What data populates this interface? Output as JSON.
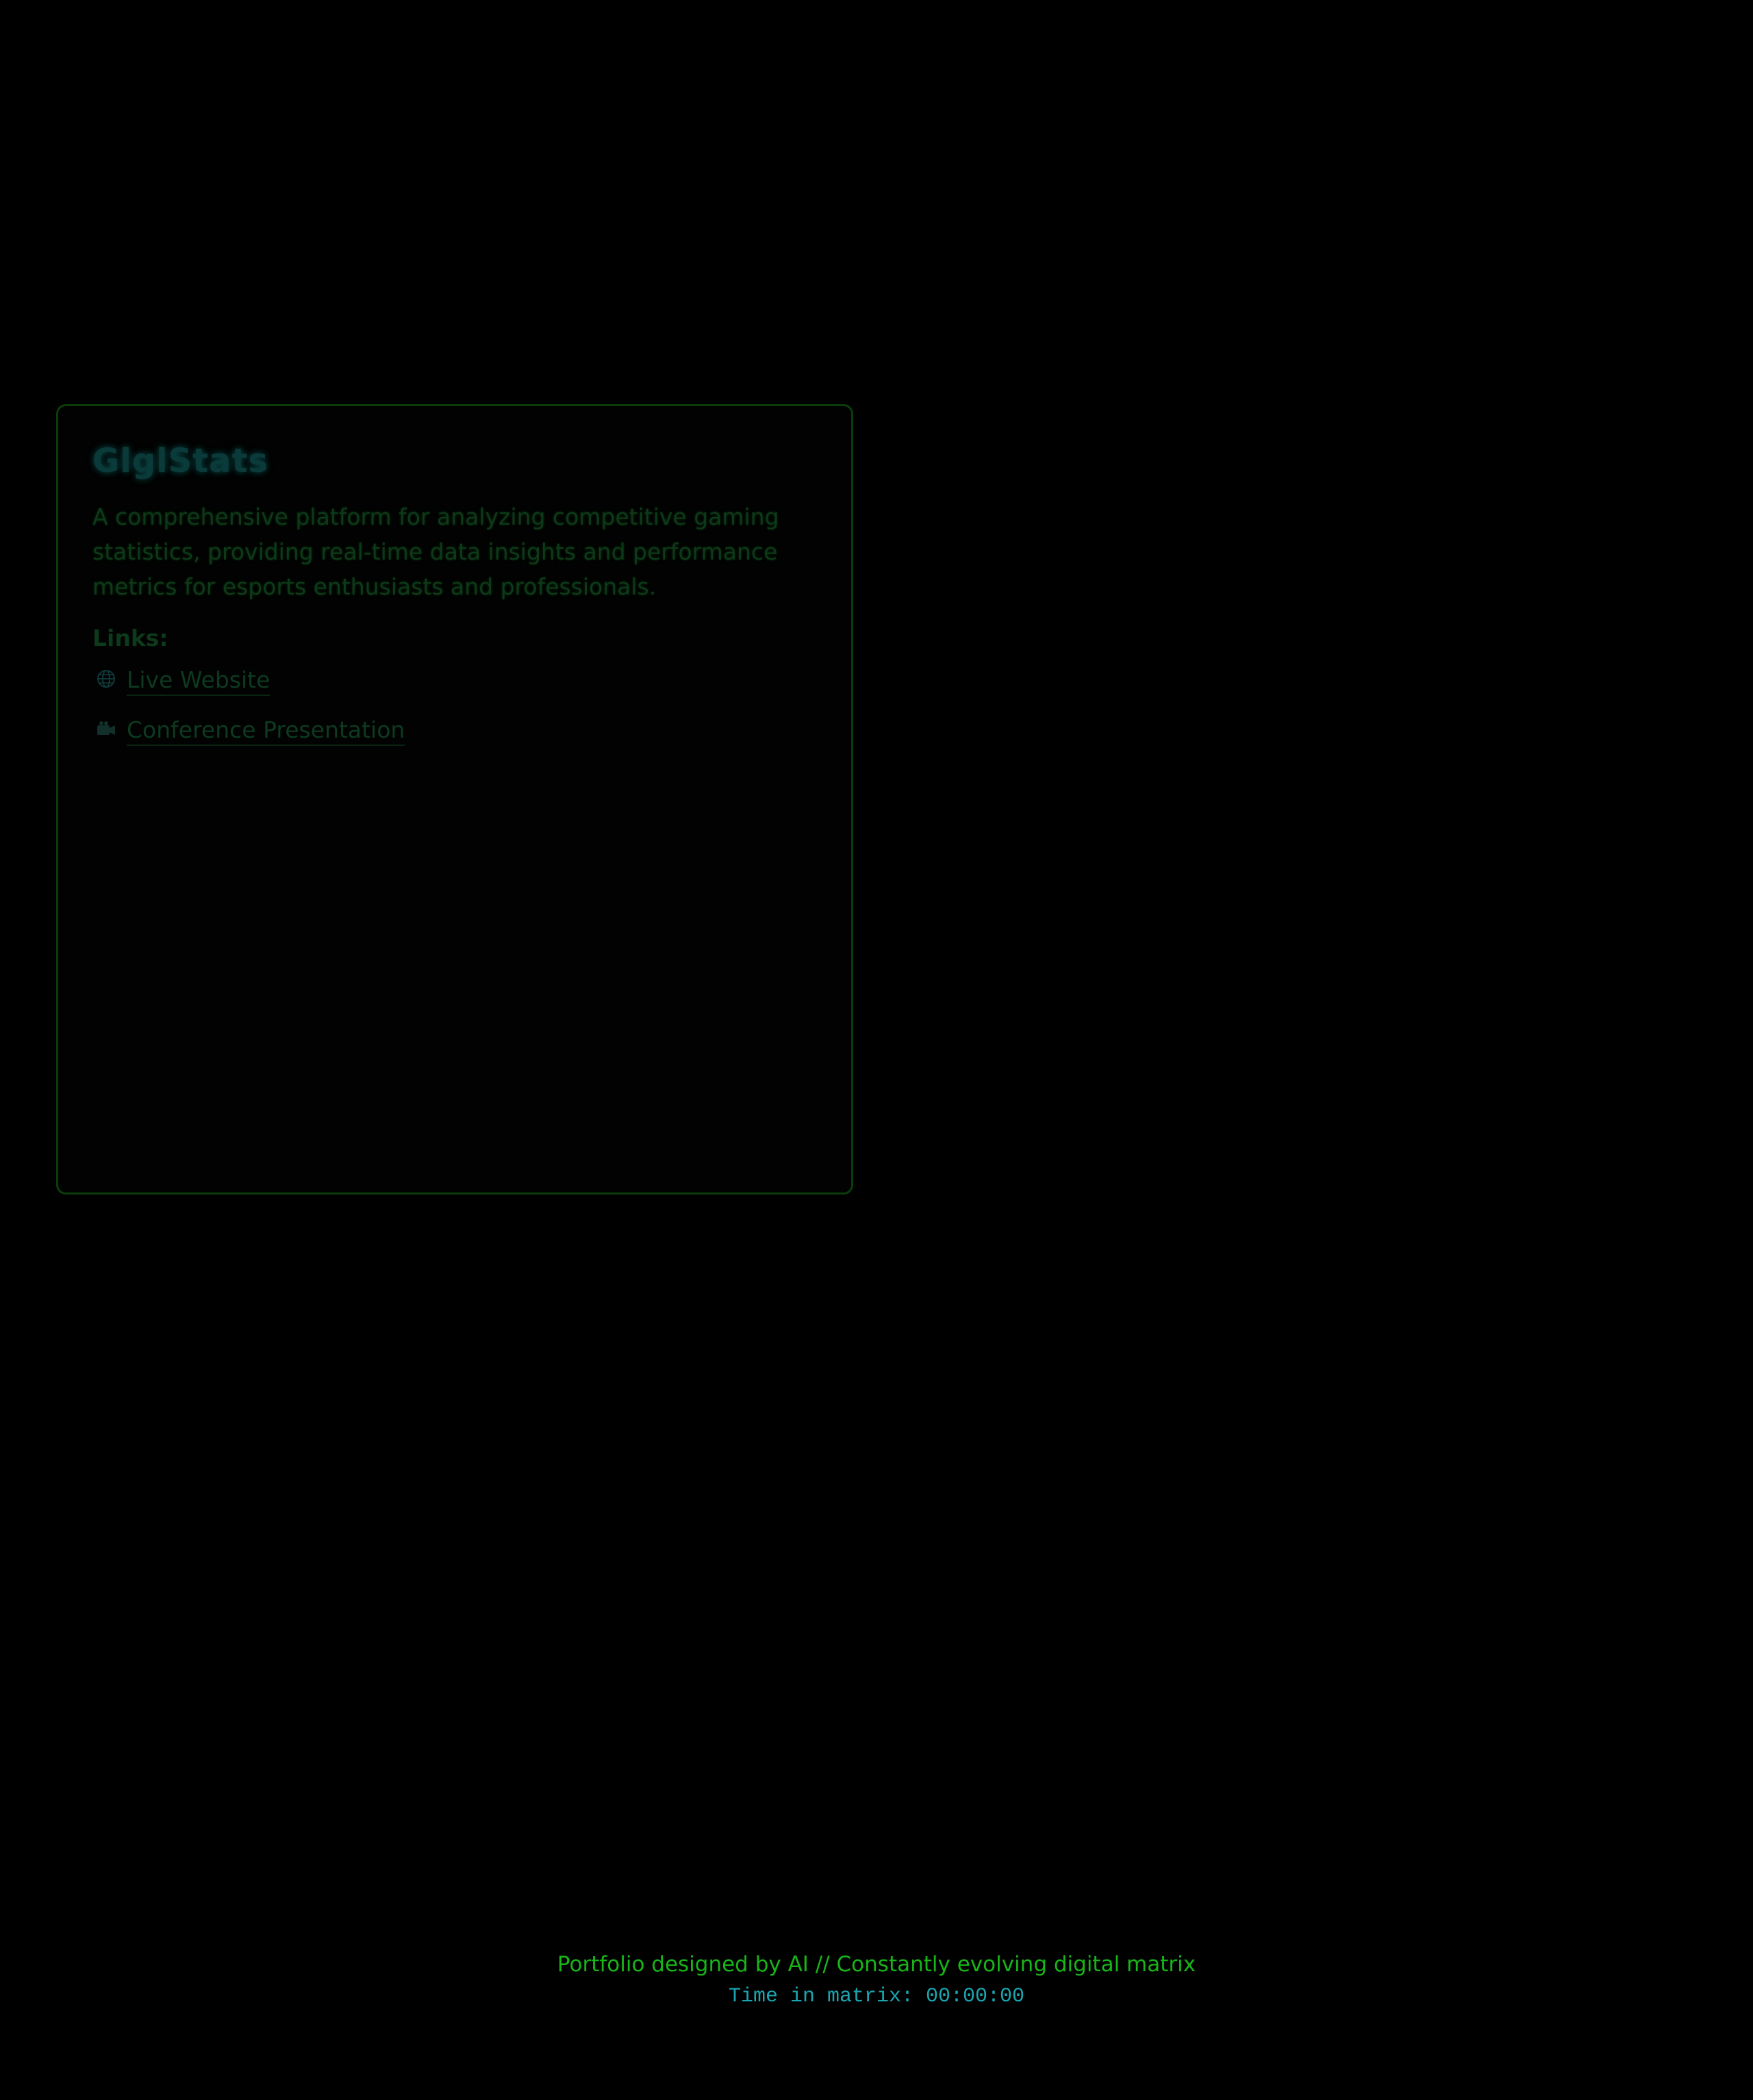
{
  "project": {
    "title": "GlglStats",
    "description": "A comprehensive platform for analyzing competitive gaming statistics, providing real-time data insights and performance metrics for esports enthusiasts and professionals.",
    "links_heading": "Links:",
    "links": [
      {
        "icon": "globe-icon",
        "label": "Live Website"
      },
      {
        "icon": "video-camera-icon",
        "label": "Conference Presentation"
      }
    ]
  },
  "footer": {
    "credit": "Portfolio designed by AI // Constantly evolving digital matrix",
    "timer": "Time in matrix: 00:00:00"
  },
  "colors": {
    "background": "#000000",
    "card_border": "#0a3d0a",
    "footer_credit": "#17b517",
    "footer_timer": "#1aa6b0"
  }
}
